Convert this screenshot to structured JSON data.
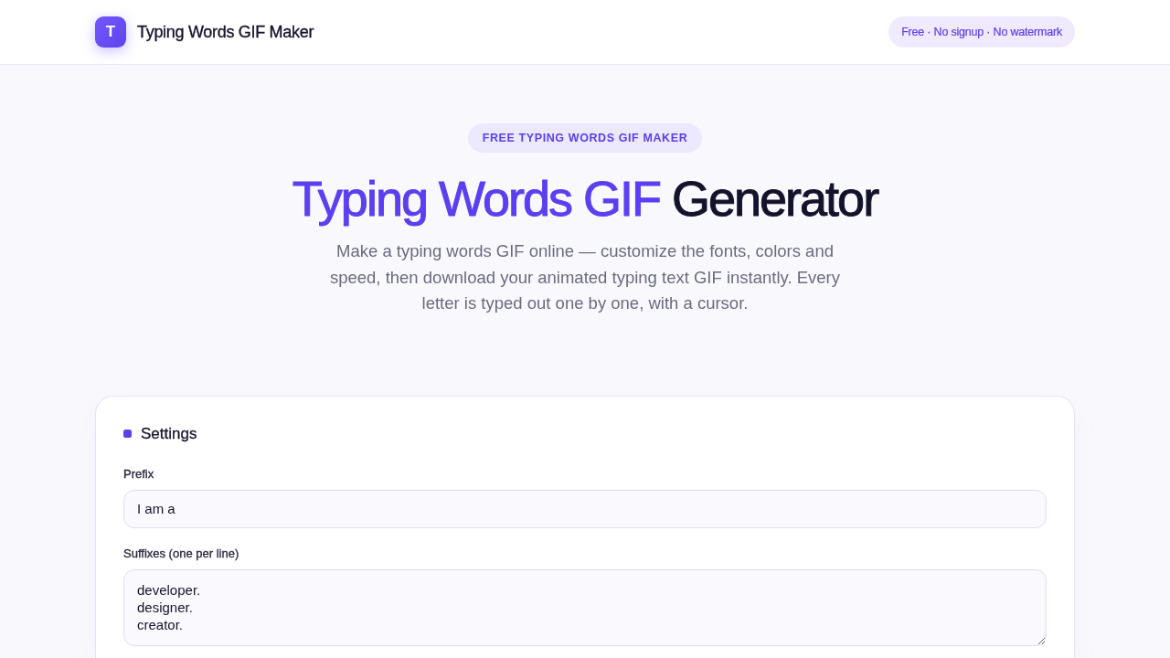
{
  "header": {
    "logo_letter": "T",
    "brand": "Typing Words GIF Maker",
    "tagline": "Free · No signup · No watermark"
  },
  "hero": {
    "eyebrow": "FREE TYPING WORDS GIF MAKER",
    "title_highlight": "Typing Words GIF",
    "title_rest": "Generator",
    "subtitle": "Make a typing words GIF online — customize the fonts, colors and speed, then download your animated typing text GIF instantly. Every letter is typed out one by one, with a cursor."
  },
  "settings": {
    "title": "Settings",
    "fields": [
      {
        "kind": "input",
        "label": "Prefix",
        "value": "I am a"
      },
      {
        "kind": "textarea",
        "label": "Suffixes (one per line)",
        "value": "developer.\ndesigner.\ncreator."
      }
    ]
  }
}
